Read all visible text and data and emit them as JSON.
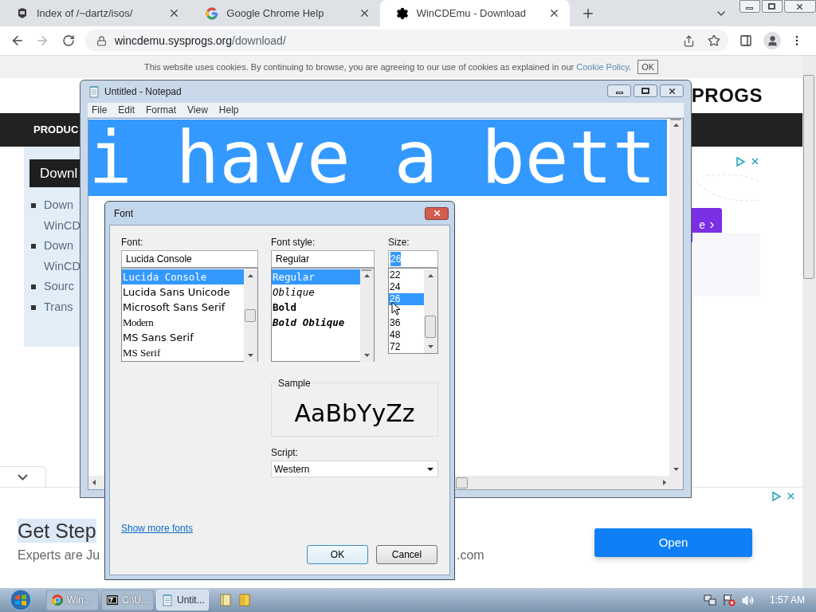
{
  "browser": {
    "tabs": [
      {
        "title": "Index of /~dartz/isos/",
        "selected": false
      },
      {
        "title": "Google Chrome Help",
        "selected": false
      },
      {
        "title": "WinCDEmu - Download",
        "selected": true
      }
    ],
    "nav": {
      "forward_disabled": true
    },
    "address": {
      "host": "wincdemu.sysprogs.org",
      "path": "/download/"
    }
  },
  "page": {
    "cookie_bar": {
      "text": "This website uses cookies. By continuing to browse, you are agreeing to our use of cookies as explained in our ",
      "link": "Cookie Policy",
      "after": ".",
      "button": "OK"
    },
    "logo": "PROGS",
    "nav_item": "PRODUC",
    "card": {
      "heading": "Downl",
      "items": [
        {
          "lines": [
            "Down",
            "WinCD"
          ]
        },
        {
          "lines": [
            "Down",
            "WinCD"
          ]
        },
        {
          "lines": [
            "Sourc"
          ]
        },
        {
          "lines": [
            "Trans"
          ]
        }
      ]
    },
    "side_ad": {
      "button": "e"
    },
    "bottom_ad": {
      "title": "Get Step",
      "subtitle": "Experts are Ju",
      "subtitle_tail": ".com",
      "button": "Open"
    }
  },
  "notepad": {
    "title": "Untitled - Notepad",
    "menu": [
      "File",
      "Edit",
      "Format",
      "View",
      "Help"
    ],
    "text": "i have a bett",
    "text_selected": true
  },
  "font_dialog": {
    "title": "Font",
    "font": {
      "label": "Font:",
      "value": "Lucida Console",
      "items": [
        {
          "label": "Lucida Console",
          "selected": true
        },
        {
          "label": "Lucida Sans Unicode",
          "selected": false
        },
        {
          "label": "Microsoft Sans Serif",
          "selected": false
        },
        {
          "label": "Modern",
          "selected": false
        },
        {
          "label": "MS Sans Serif",
          "selected": false
        },
        {
          "label": "MS Serif",
          "selected": false
        }
      ]
    },
    "style": {
      "label": "Font style:",
      "value": "Regular",
      "items": [
        {
          "label": "Regular",
          "selected": true
        },
        {
          "label": "Oblique",
          "selected": false
        },
        {
          "label": "Bold",
          "selected": false
        },
        {
          "label": "Bold Oblique",
          "selected": false
        }
      ]
    },
    "size": {
      "label": "Size:",
      "value": "26",
      "value_selected": true,
      "items": [
        {
          "kind": "size",
          "label": "22",
          "selected": false
        },
        {
          "kind": "size",
          "label": "24",
          "selected": false
        },
        {
          "kind": "size",
          "label": "26",
          "selected": true
        },
        {
          "kind": "cursor"
        },
        {
          "kind": "size",
          "label": "36",
          "selected": false
        },
        {
          "kind": "size",
          "label": "48",
          "selected": false
        },
        {
          "kind": "size",
          "label": "72",
          "selected": false
        }
      ]
    },
    "sample": {
      "label": "Sample",
      "text": "AaBbYyZz"
    },
    "script": {
      "label": "Script:",
      "value": "Western"
    },
    "link": "Show more fonts",
    "ok": "OK",
    "cancel": "Cancel"
  },
  "taskbar": {
    "buttons": [
      {
        "label": "Win...",
        "selected": false
      },
      {
        "label": "C:\\U...",
        "selected": false
      },
      {
        "label": "Untit...",
        "selected": true
      }
    ],
    "clock": "1:57 AM"
  }
}
